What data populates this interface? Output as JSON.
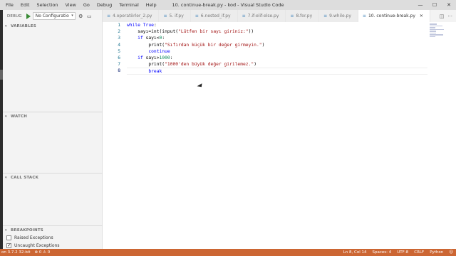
{
  "menu": [
    "File",
    "Edit",
    "Selection",
    "View",
    "Go",
    "Debug",
    "Terminal",
    "Help"
  ],
  "window_title": "10. continue-break.py - kod - Visual Studio Code",
  "window_controls": {
    "minimize": "—",
    "maximize": "☐",
    "close": "✕"
  },
  "debug": {
    "label": "DEBUG",
    "configuration": "No Configuratio",
    "caret": "▾",
    "gear": "⚙",
    "terminal": "▭"
  },
  "sections": {
    "variables": "VARIABLES",
    "watch": "WATCH",
    "call_stack": "CALL STACK",
    "breakpoints": "BREAKPOINTS",
    "chevron": "▾"
  },
  "breakpoints": [
    {
      "label": "Raised Exceptions",
      "checked": false
    },
    {
      "label": "Uncaught Exceptions",
      "checked": true
    }
  ],
  "tabs": [
    {
      "label": "4.operatörler_2.py",
      "icon": "≡"
    },
    {
      "label": "5. if.py",
      "icon": "≡"
    },
    {
      "label": "6.nested_if.py",
      "icon": "≡"
    },
    {
      "label": "7.if-elif-else.py",
      "icon": "≡"
    },
    {
      "label": "8.for.py",
      "icon": "≡"
    },
    {
      "label": "9.while.py",
      "icon": "≡"
    },
    {
      "label": "10. continue-break.py",
      "icon": "≡",
      "close": "✕"
    }
  ],
  "tab_actions": {
    "split": "◫",
    "more": "···"
  },
  "editor": {
    "line_numbers": [
      "1",
      "2",
      "3",
      "4",
      "5",
      "6",
      "7",
      "8"
    ],
    "lines": [
      [
        {
          "t": "while",
          "c": "kw"
        },
        {
          "t": " "
        },
        {
          "t": "True",
          "c": "kw"
        },
        {
          "t": ":"
        }
      ],
      [
        {
          "t": "    sayı=int(input("
        },
        {
          "t": "\"Lütfen bir sayı giriniz:\"",
          "c": "str"
        },
        {
          "t": "))"
        }
      ],
      [
        {
          "t": "    "
        },
        {
          "t": "if",
          "c": "kw"
        },
        {
          "t": " sayı<"
        },
        {
          "t": "0",
          "c": "num"
        },
        {
          "t": ":"
        }
      ],
      [
        {
          "t": "        print("
        },
        {
          "t": "\"Sıfırdan küçük bir değer girmeyin.\"",
          "c": "str"
        },
        {
          "t": ")"
        }
      ],
      [
        {
          "t": "        "
        },
        {
          "t": "continue",
          "c": "kw"
        }
      ],
      [
        {
          "t": "    "
        },
        {
          "t": "if",
          "c": "kw"
        },
        {
          "t": " sayı>"
        },
        {
          "t": "1000",
          "c": "num"
        },
        {
          "t": ":"
        }
      ],
      [
        {
          "t": "        print("
        },
        {
          "t": "\"1000'den büyük değer girilemez.\"",
          "c": "str"
        },
        {
          "t": ")"
        }
      ],
      [
        {
          "t": "        "
        },
        {
          "t": "break",
          "c": "kw"
        }
      ]
    ]
  },
  "status": {
    "left": [
      "on 3.7.2 32-bit",
      "⊗ 0 ⚠ 0"
    ],
    "right": [
      "Ln 8, Col 14",
      "Spaces: 4",
      "UTF-8",
      "CRLF",
      "Python",
      "☺"
    ]
  }
}
